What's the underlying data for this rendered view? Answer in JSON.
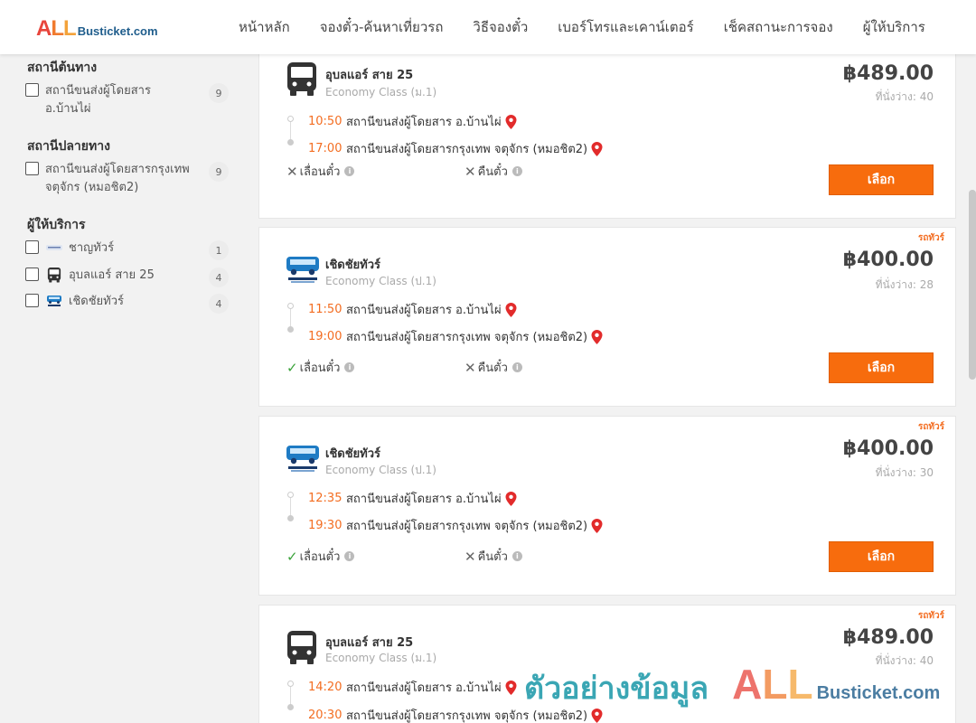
{
  "header": {
    "logo_all_a": "A",
    "logo_all_l1": "L",
    "logo_all_l2": "L",
    "logo_rest": "Busticket.com",
    "nav": [
      "หน้าหลัก",
      "จองตั๋ว-ค้นหาเที่ยวรถ",
      "วิธีจองตั๋ว",
      "เบอร์โทรและเคาน์เตอร์",
      "เช็คสถานะการจอง",
      "ผู้ให้บริการ"
    ]
  },
  "sidebar": {
    "origin_title": "สถานีต้นทาง",
    "origin": [
      {
        "label": "สถานีขนส่งผู้โดยสาร อ.บ้านไผ่",
        "count": "9"
      }
    ],
    "destination_title": "สถานีปลายทาง",
    "destination": [
      {
        "label": "สถานีขนส่งผู้โดยสารกรุงเทพ จตุจักร (หมอชิต2)",
        "count": "9"
      }
    ],
    "operators_title": "ผู้ให้บริการ",
    "operators": [
      {
        "label": "ชาญทัวร์",
        "count": "1"
      },
      {
        "label": "อุบลแอร์ สาย 25",
        "count": "4"
      },
      {
        "label": "เชิดชัยทัวร์",
        "count": "4"
      }
    ]
  },
  "results": [
    {
      "operator": "อุบลแอร์ สาย 25",
      "class": "Economy Class (ม.1)",
      "tag": "",
      "price": "฿489.00",
      "seats": "ที่นั่งว่าง: 40",
      "dep_time": "10:50",
      "dep_place": "สถานีขนส่งผู้โดยสาร อ.บ้านไผ่",
      "arr_time": "17:00",
      "arr_place": "สถานีขนส่งผู้โดยสารกรุงเทพ จตุจักร (หมอชิต2)",
      "change_label": "เลื่อนตั๋ว",
      "change_mark": "✕",
      "refund_label": "คืนตั๋ว",
      "refund_mark": "✕",
      "select_label": "เลือก"
    },
    {
      "operator": "เชิดชัยทัวร์",
      "class": "Economy Class (ป.1)",
      "tag": "รถทัวร์",
      "price": "฿400.00",
      "seats": "ที่นั่งว่าง: 28",
      "dep_time": "11:50",
      "dep_place": "สถานีขนส่งผู้โดยสาร อ.บ้านไผ่",
      "arr_time": "19:00",
      "arr_place": "สถานีขนส่งผู้โดยสารกรุงเทพ จตุจักร (หมอชิต2)",
      "change_label": "เลื่อนตั๋ว",
      "change_mark": "✓",
      "refund_label": "คืนตั๋ว",
      "refund_mark": "✕",
      "select_label": "เลือก"
    },
    {
      "operator": "เชิดชัยทัวร์",
      "class": "Economy Class (ป.1)",
      "tag": "รถทัวร์",
      "price": "฿400.00",
      "seats": "ที่นั่งว่าง: 30",
      "dep_time": "12:35",
      "dep_place": "สถานีขนส่งผู้โดยสาร อ.บ้านไผ่",
      "arr_time": "19:30",
      "arr_place": "สถานีขนส่งผู้โดยสารกรุงเทพ จตุจักร (หมอชิต2)",
      "change_label": "เลื่อนตั๋ว",
      "change_mark": "✓",
      "refund_label": "คืนตั๋ว",
      "refund_mark": "✕",
      "select_label": "เลือก"
    },
    {
      "operator": "อุบลแอร์ สาย 25",
      "class": "Economy Class (ม.1)",
      "tag": "รถทัวร์",
      "price": "฿489.00",
      "seats": "ที่นั่งว่าง: 40",
      "dep_time": "14:20",
      "dep_place": "สถานีขนส่งผู้โดยสาร อ.บ้านไผ่",
      "arr_time": "20:30",
      "arr_place": "สถานีขนส่งผู้โดยสารกรุงเทพ จตุจักร (หมอชิต2)"
    }
  ],
  "watermark": {
    "thai": "ตัวอย่างข้อมูล",
    "all_a": "A",
    "all_l1": "L",
    "all_l2": "L",
    "rest": "Busticket.com"
  },
  "colors": {
    "accent": "#f76c0d",
    "time": "#f36d21",
    "check": "#3aa33a"
  }
}
